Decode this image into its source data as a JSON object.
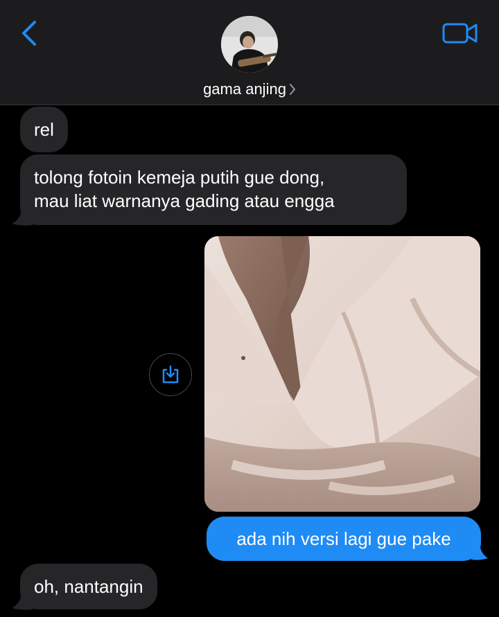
{
  "header": {
    "contact_name": "gama anjing",
    "back_icon": "chevron-left-icon",
    "video_icon": "video-camera-icon",
    "accent": "#1f8bf5",
    "background": "#1c1c1e"
  },
  "messages": [
    {
      "direction": "incoming",
      "lines": [
        "rel"
      ]
    },
    {
      "direction": "incoming",
      "lines": [
        "tolong fotoin kemeja putih gue dong,",
        "mau liat warnanya gading atau engga"
      ]
    },
    {
      "direction": "outgoing",
      "type": "image",
      "description_icon": "photo-attachment",
      "action_icon": "save-download-icon"
    },
    {
      "direction": "outgoing",
      "lines": [
        "ada nih versi lagi gue pake"
      ]
    },
    {
      "direction": "incoming",
      "lines": [
        "oh, nantangin"
      ]
    }
  ],
  "colors": {
    "incoming_bubble": "#262629",
    "outgoing_bubble": "#1f8bf5",
    "screen_background": "#000000"
  }
}
